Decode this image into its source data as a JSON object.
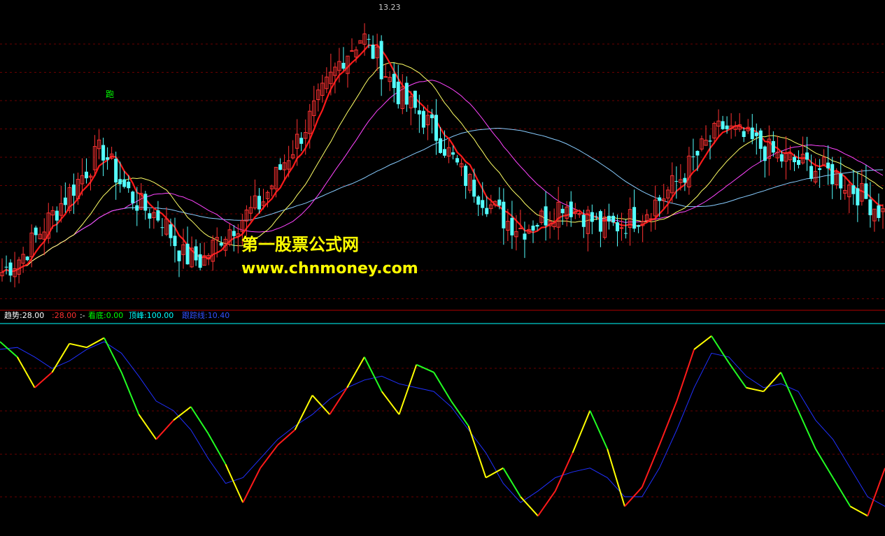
{
  "watermark": {
    "title": "第一股票公式网",
    "url": "www.chnmoney.com"
  },
  "price_panel": {
    "high_label": "13.23",
    "signal_label": "跑"
  },
  "indicator_panel": {
    "legend": [
      {
        "label": "趋势:28.00",
        "color": "#ffffff"
      },
      {
        "label": ":28.00",
        "color": "#ff3030"
      },
      {
        "label": ":-",
        "color": "#ffffff"
      },
      {
        "label": "看底:0.00",
        "color": "#00ff00"
      },
      {
        "label": "顶峰:100.00",
        "color": "#00ffff"
      },
      {
        "label": "跟踪线:10.40",
        "color": "#3050ff"
      }
    ]
  },
  "colors": {
    "background": "#000000",
    "up_candle": "#ff3232",
    "down_candle": "#54ffff",
    "ma_short": "#ff1a1a",
    "ma_mid": "#ffff66",
    "ma_long": "#ff44ff",
    "ma_longest": "#88ccff",
    "trend_up": "#ff1a1a",
    "trend_down": "#22ff22",
    "trend_turn": "#ffff00",
    "signal_line": "#2030ff",
    "limit_line": "#00ffff",
    "grid": "#6a0000",
    "divider": "#b00000"
  },
  "chart_data": [
    {
      "type": "candlestick",
      "title": "",
      "annotations": [
        {
          "text": "13.23",
          "kind": "high-price"
        },
        {
          "text": "跑",
          "kind": "sell-signal"
        }
      ],
      "price_path": [
        8.6,
        8.9,
        9.4,
        9.9,
        10.4,
        10.9,
        10.2,
        9.8,
        9.6,
        8.9,
        8.8,
        9.3,
        9.6,
        9.9,
        10.6,
        11.2,
        11.9,
        12.6,
        13.0,
        12.4,
        11.8,
        11.5,
        11.0,
        10.4,
        10.0,
        9.6,
        9.4,
        9.6,
        9.9,
        9.7,
        9.4,
        9.5,
        9.7,
        10.0,
        10.4,
        10.9,
        11.3,
        11.1,
        10.9,
        10.7,
        10.6,
        10.5,
        10.3,
        10.0,
        9.7
      ],
      "series": [
        {
          "name": "MA short",
          "style": "thick red"
        },
        {
          "name": "MA mid",
          "style": "thin yellow"
        },
        {
          "name": "MA long",
          "style": "thin magenta"
        },
        {
          "name": "MA longest",
          "style": "thin light blue"
        }
      ]
    },
    {
      "type": "line",
      "title": "趋势",
      "ylim": [
        0,
        100
      ],
      "reference_values": {
        "top": 100,
        "bottom": 0
      },
      "trend": [
        96,
        88,
        72,
        80,
        95,
        93,
        98,
        80,
        58,
        45,
        55,
        62,
        48,
        32,
        12,
        30,
        42,
        50,
        68,
        58,
        72,
        88,
        70,
        58,
        84,
        80,
        65,
        52,
        25,
        30,
        15,
        5,
        18,
        38,
        60,
        40,
        10,
        20,
        42,
        65,
        92,
        99,
        85,
        72,
        70,
        80,
        60,
        40,
        25,
        10,
        5,
        30
      ],
      "signal": [
        92,
        93,
        88,
        82,
        86,
        92,
        96,
        90,
        78,
        65,
        60,
        50,
        35,
        22,
        25,
        35,
        45,
        52,
        58,
        66,
        72,
        76,
        78,
        74,
        72,
        70,
        62,
        50,
        38,
        22,
        12,
        18,
        25,
        28,
        30,
        25,
        15,
        15,
        30,
        50,
        72,
        90,
        88,
        78,
        72,
        74,
        70,
        55,
        45,
        30,
        15,
        10
      ]
    }
  ]
}
